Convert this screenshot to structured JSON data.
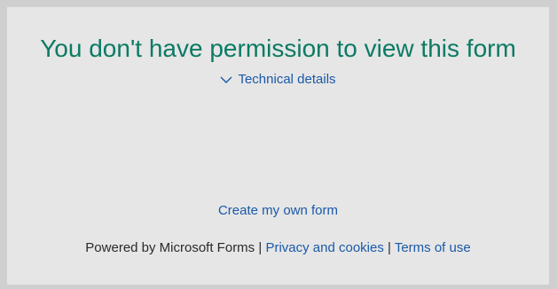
{
  "message": {
    "title": "You don't have permission to view this form"
  },
  "technical_details": {
    "label": "Technical details",
    "icon": "chevron-down-icon"
  },
  "create_link": "Create my own form",
  "footer": {
    "powered_by": "Powered by Microsoft Forms",
    "separator": "|",
    "privacy_link": "Privacy and cookies",
    "terms_link": "Terms of use"
  },
  "colors": {
    "title": "#0b7a64",
    "link": "#1a59a8",
    "panel": "#e6e6e6",
    "outer": "#cfcfcf"
  }
}
